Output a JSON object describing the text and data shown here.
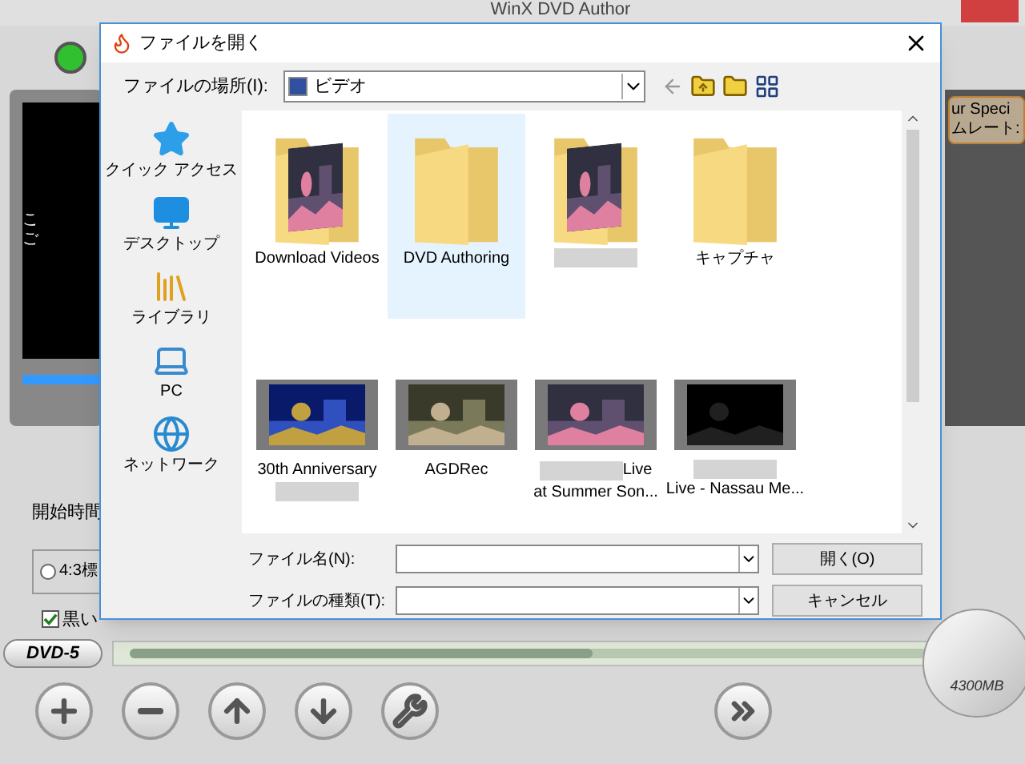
{
  "app": {
    "title": "WinX DVD Author",
    "preview_text": [
      "こ",
      "ご"
    ],
    "side_panel": [
      "ur Speci",
      "ムレート:"
    ],
    "start_time_label": "開始時間",
    "aspect_option": {
      "label": "4:3標",
      "selected": false
    },
    "black_option": {
      "label": "黒い",
      "checked": true
    },
    "disc_type": "DVD-5",
    "progress": {
      "level": 0.58
    },
    "disc_size": "4300MB"
  },
  "dialog": {
    "title": "ファイルを開く",
    "location_label": "ファイルの場所(I):",
    "location_value": "ビデオ",
    "nav": [
      {
        "kind": "star",
        "label": "クイック アクセス"
      },
      {
        "kind": "desktop",
        "label": "デスクトップ"
      },
      {
        "kind": "library",
        "label": "ライブラリ"
      },
      {
        "kind": "pc",
        "label": "PC"
      },
      {
        "kind": "network",
        "label": "ネットワーク"
      }
    ],
    "files": [
      {
        "kind": "folder",
        "lines": [
          [
            {
              "kind": "text",
              "text": "Download Videos"
            }
          ]
        ],
        "selected": false,
        "photos": true
      },
      {
        "kind": "folder",
        "lines": [
          [
            {
              "kind": "text",
              "text": "DVD Authoring"
            }
          ]
        ],
        "selected": true,
        "photos": false
      },
      {
        "kind": "folder",
        "lines": [
          [
            {
              "kind": "blur"
            }
          ]
        ],
        "selected": false,
        "photos": true
      },
      {
        "kind": "folder",
        "lines": [
          [
            {
              "kind": "text",
              "text": "キャプチャ"
            }
          ]
        ],
        "selected": false,
        "photos": false
      },
      {
        "kind": "video",
        "lines": [
          [
            {
              "kind": "text",
              "text": "30th Anniversary"
            }
          ],
          [
            {
              "kind": "blur"
            }
          ]
        ],
        "selected": false
      },
      {
        "kind": "video",
        "lines": [
          [
            {
              "kind": "text",
              "text": "AGDRec"
            }
          ]
        ],
        "selected": false
      },
      {
        "kind": "video",
        "lines": [
          [
            {
              "kind": "blur"
            },
            {
              "kind": "text",
              "text": "Live"
            }
          ],
          [
            {
              "kind": "text",
              "text": "at Summer Son..."
            }
          ]
        ],
        "selected": false
      },
      {
        "kind": "video",
        "lines": [
          [
            {
              "kind": "blur"
            }
          ],
          [
            {
              "kind": "text",
              "text": "Live - Nassau Me..."
            }
          ]
        ],
        "selected": false
      }
    ],
    "filename_label": "ファイル名(N):",
    "filetype_label": "ファイルの種類(T):",
    "open_button": "開く(O)",
    "cancel_button": "キャンセル"
  }
}
